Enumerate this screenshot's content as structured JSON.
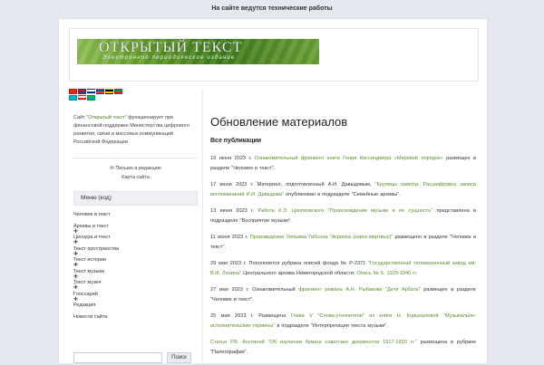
{
  "notice": "На сайте ведутся технические работы",
  "header": {
    "logo_title": "ОТКРЫТЫЙ ТЕКСТ",
    "logo_subtitle": "Электронное периодическое издание"
  },
  "flags": [
    {
      "name": "flag-china",
      "colors": [
        "#de2910",
        "#de2910"
      ]
    },
    {
      "name": "flag-usa",
      "colors": [
        "#b22234",
        "#3c3b6e"
      ]
    },
    {
      "name": "flag-finland",
      "colors": [
        "#ffffff",
        "#003580"
      ]
    },
    {
      "name": "flag-france",
      "colors": [
        "#0055a4",
        "#ef4135"
      ]
    },
    {
      "name": "flag-germany",
      "colors": [
        "#000000",
        "#ffce00"
      ]
    },
    {
      "name": "flag-italy",
      "colors": [
        "#009246",
        "#ce2b37"
      ]
    },
    {
      "name": "flag-kazakhstan",
      "colors": [
        "#00afca",
        "#00afca"
      ]
    },
    {
      "name": "flag-russia",
      "colors": [
        "#ffffff",
        "#d52b1e"
      ]
    },
    {
      "name": "flag-uzbekistan",
      "colors": [
        "#1eb53a",
        "#0099b5"
      ]
    }
  ],
  "sidebar": {
    "about_prefix": "Сайт ",
    "about_highlight": "\"Открытый текст\"",
    "about_rest": " функционирует при финансовой поддержке Министерства цифрового развития, связи и массовых коммуникаций Российской Федерации",
    "mail_link": "✉ Письмо в редакцию",
    "sitemap_link": "Карта сайта",
    "menu_title": "Меню (код)",
    "menu_items": [
      {
        "label": "Человек и текст",
        "plus": false
      },
      {
        "label": "Архивы и текст",
        "plus": true
      },
      {
        "label": "Цензура и текст",
        "plus": true
      },
      {
        "label": "Текст пространства",
        "plus": true
      },
      {
        "label": "Текст истории",
        "plus": true
      },
      {
        "label": "Текст музыки",
        "plus": true
      },
      {
        "label": "Текст музея",
        "plus": true
      },
      {
        "label": "Глоссарий",
        "plus": true
      },
      {
        "label": "Редакция",
        "plus": false
      },
      {
        "label": "Новости сайта",
        "plus": false
      }
    ],
    "search_placeholder": "",
    "search_button": "Поиск"
  },
  "main": {
    "title": "Обновление материалов",
    "subtitle": "Все публикации",
    "entries": [
      [
        {
          "t": "19 июня 2023 г. "
        },
        {
          "t": "Ознакомительный фрагмент книги Генри Киссинджера «Мировой порядок»",
          "link": true
        },
        {
          "t": " размещен в разделе \"Человек и текст\"."
        }
      ],
      [
        {
          "t": "17 июня 2023 г. Материал, подготовленный А.И. Давыдовым, "
        },
        {
          "t": "\"Крупицы памяти. Расшифровка записи воспоминаний И.И. Давыдова\"",
          "link": true
        },
        {
          "t": " опубликован в подразделе \"Семейные архивы\"."
        }
      ],
      [
        {
          "t": "13 июня 2023 г. "
        },
        {
          "t": "Работа К.Э. Циолковского \"Происхождение музыки и ее сущность\"",
          "link": true
        },
        {
          "t": " представлена в подразделе \"Восприятие музыки\"."
        }
      ],
      [
        {
          "t": "11 июня 2023 г. "
        },
        {
          "t": "Произведение Уильяма Гибсона \"Агриппа (книга мертвых)\"",
          "link": true
        },
        {
          "t": " размещено в разделе \"Человек и текст\"."
        }
      ],
      [
        {
          "t": "29 мая 2023 г. Пополняется рубрика описей фонда № Р-2371 "
        },
        {
          "t": "\"Государственный телевизионный завод им. В.И. Ленина\"",
          "link": true
        },
        {
          "t": " Центрального архива Нижегородской области: "
        },
        {
          "t": "Опись № 5. 1929-1940 гг.",
          "link": true
        }
      ],
      [
        {
          "t": "27 мая 2023 г. Ознакомительный "
        },
        {
          "t": "фрагмент романа А.Н. Рыбакова \"Дети Арбата\"",
          "link": true
        },
        {
          "t": " размещен в разделе \"Человек и текст\"."
        }
      ],
      [
        {
          "t": "25 мая 2023 г. Размещена "
        },
        {
          "t": "Глава V \"Слова-уточнители\" из книги Н. Корыхаловой \"Музыкально-исполнительские термины\"",
          "link": true
        },
        {
          "t": " в подразделе \"Интерпретация текста музыки\"."
        }
      ],
      [
        {
          "t": "Статья Р.В. Костиной \"Об изучении бумаги советских документов 1917-1920 гг.\"",
          "link": true
        },
        {
          "t": " размещена в рубрике \"Палеография\"."
        }
      ]
    ]
  }
}
